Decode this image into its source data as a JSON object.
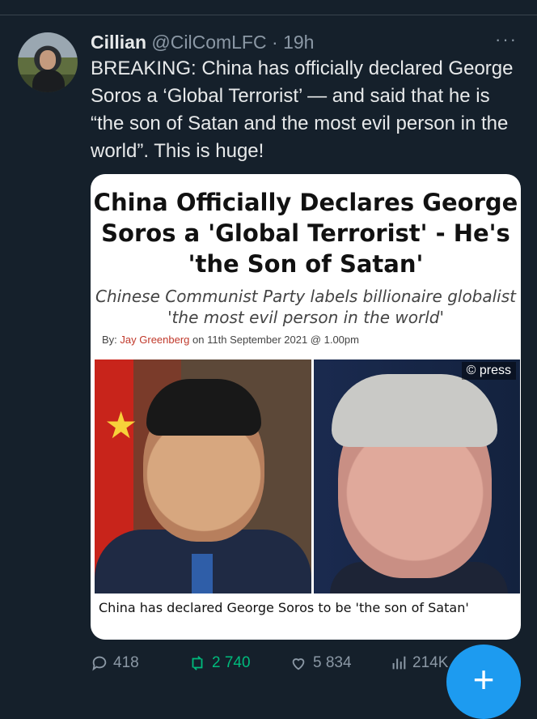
{
  "tweet": {
    "name": "Cillian",
    "handle": "@CilComLFC",
    "separator": "·",
    "time": "19h",
    "more_label": "···",
    "text": "BREAKING: China has officially declared George Soros a ‘Global Terrorist’ — and said that he is “the son of Satan and the most evil person in the world”. This is huge!"
  },
  "card": {
    "headline": "China Officially Declares George Soros a 'Global Terrorist' - He's 'the Son of Satan'",
    "subheadline": "Chinese Communist Party labels billionaire globalist 'the most evil person in the world'",
    "byline_prefix": "By:",
    "author": "Jay Greenberg",
    "date_text": "on 11th September 2021 @ 1.00pm",
    "image_credit": "© press",
    "caption": "China has declared George Soros to be 'the son of Satan'"
  },
  "actions": {
    "replies": "418",
    "retweets": "2 740",
    "likes": "5 834",
    "views": "214K"
  },
  "colors": {
    "background": "#15202b",
    "accent": "#1d9bf0",
    "retweet": "#00ba7c",
    "muted": "#8b98a5"
  },
  "icons": [
    "reply-icon",
    "retweet-icon",
    "like-icon",
    "views-icon",
    "share-icon",
    "compose-icon"
  ]
}
